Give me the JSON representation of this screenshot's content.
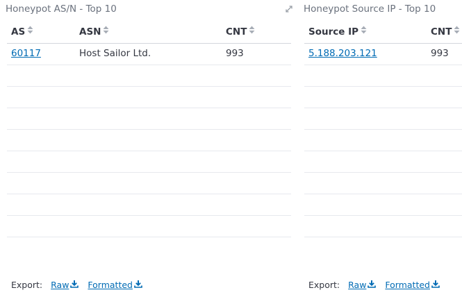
{
  "left_panel": {
    "title": "Honeypot AS/N - Top 10",
    "columns": [
      "AS",
      "ASN",
      "CNT"
    ],
    "rows": [
      {
        "as": "60117",
        "asn": "Host Sailor Ltd.",
        "cnt": "993"
      }
    ],
    "export": {
      "label": "Export:",
      "raw": "Raw",
      "formatted": "Formatted"
    }
  },
  "right_panel": {
    "title": "Honeypot Source IP - Top 10",
    "columns": [
      "Source IP",
      "CNT"
    ],
    "rows": [
      {
        "source_ip": "5.188.203.121",
        "cnt": "993"
      }
    ],
    "export": {
      "label": "Export:",
      "raw": "Raw",
      "formatted": "Formatted"
    }
  },
  "icons": {
    "expand": "expand-icon",
    "sort": "sort-icon",
    "download": "download-icon"
  },
  "colors": {
    "link": "#006bb4",
    "title": "#6a717d",
    "text": "#343741",
    "border": "#e7e9ee"
  }
}
